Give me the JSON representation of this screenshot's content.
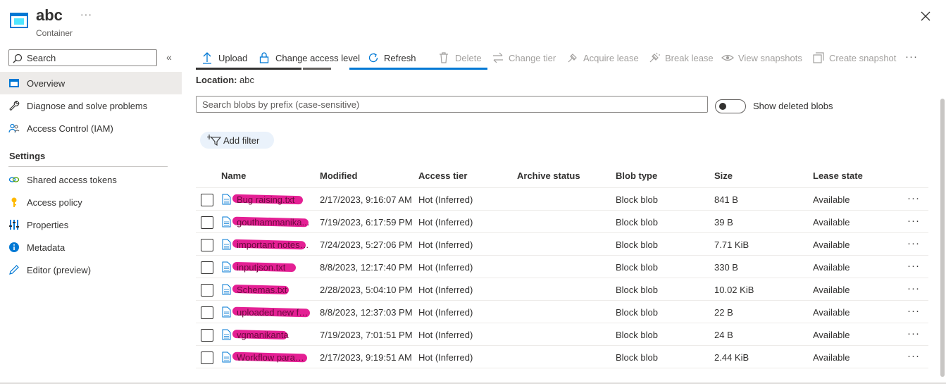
{
  "header": {
    "title": "abc",
    "subtitle": "Container",
    "more_label": "···"
  },
  "sidebar": {
    "search_placeholder": "Search",
    "collapse_label": "«",
    "items": [
      {
        "label": "Overview",
        "icon": "overview-icon",
        "active": true
      },
      {
        "label": "Diagnose and solve problems",
        "icon": "wrench-icon"
      },
      {
        "label": "Access Control (IAM)",
        "icon": "people-icon"
      }
    ],
    "settings_title": "Settings",
    "settings_items": [
      {
        "label": "Shared access tokens",
        "icon": "link-icon"
      },
      {
        "label": "Access policy",
        "icon": "key-icon"
      },
      {
        "label": "Properties",
        "icon": "sliders-icon"
      },
      {
        "label": "Metadata",
        "icon": "info-icon"
      },
      {
        "label": "Editor (preview)",
        "icon": "pencil-icon"
      }
    ]
  },
  "toolbar": {
    "upload": "Upload",
    "change_access_level": "Change access level",
    "refresh": "Refresh",
    "delete": "Delete",
    "change_tier": "Change tier",
    "acquire_lease": "Acquire lease",
    "break_lease": "Break lease",
    "view_snapshots": "View snapshots",
    "create_snapshot": "Create snapshot",
    "more": "···"
  },
  "details": {
    "location_label": "Location:",
    "location_value": "abc"
  },
  "prefix_search": {
    "placeholder": "Search blobs by prefix (case-sensitive)"
  },
  "show_deleted_label": "Show deleted blobs",
  "add_filter_label": "Add filter",
  "table": {
    "columns": [
      "Name",
      "Modified",
      "Access tier",
      "Archive status",
      "Blob type",
      "Size",
      "Lease state"
    ],
    "rows": [
      {
        "name": "Bug raising.txt",
        "modified": "2/17/2023, 9:16:07 AM",
        "tier": "Hot (Inferred)",
        "archive": "",
        "type": "Block blob",
        "size": "841 B",
        "lease": "Available"
      },
      {
        "name": "gouthammanika...",
        "modified": "7/19/2023, 6:17:59 PM",
        "tier": "Hot (Inferred)",
        "archive": "",
        "type": "Block blob",
        "size": "39 B",
        "lease": "Available"
      },
      {
        "name": "important notes ...",
        "modified": "7/24/2023, 5:27:06 PM",
        "tier": "Hot (Inferred)",
        "archive": "",
        "type": "Block blob",
        "size": "7.71 KiB",
        "lease": "Available"
      },
      {
        "name": "inputjson.txt",
        "modified": "8/8/2023, 12:17:40 PM",
        "tier": "Hot (Inferred)",
        "archive": "",
        "type": "Block blob",
        "size": "330 B",
        "lease": "Available"
      },
      {
        "name": "Schemas.txt",
        "modified": "2/28/2023, 5:04:10 PM",
        "tier": "Hot (Inferred)",
        "archive": "",
        "type": "Block blob",
        "size": "10.02 KiB",
        "lease": "Available"
      },
      {
        "name": "uploaded new fil...",
        "modified": "8/8/2023, 12:37:03 PM",
        "tier": "Hot (Inferred)",
        "archive": "",
        "type": "Block blob",
        "size": "22 B",
        "lease": "Available"
      },
      {
        "name": "vgmanikanta",
        "modified": "7/19/2023, 7:01:51 PM",
        "tier": "Hot (Inferred)",
        "archive": "",
        "type": "Block blob",
        "size": "24 B",
        "lease": "Available"
      },
      {
        "name": "Workflow param...",
        "modified": "2/17/2023, 9:19:51 AM",
        "tier": "Hot (Inferred)",
        "archive": "",
        "type": "Block blob",
        "size": "2.44 KiB",
        "lease": "Available"
      }
    ],
    "row_more_label": "···"
  },
  "colors": {
    "accent": "#0078d4",
    "redaction": "#e3148e"
  }
}
